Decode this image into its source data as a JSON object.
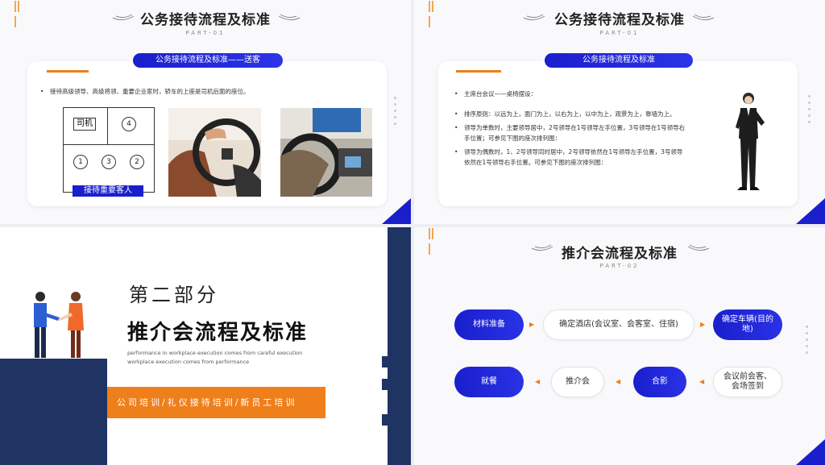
{
  "slide1": {
    "title": "公务接待流程及标准",
    "part": "PART-01",
    "card_title": "公务接待流程及标准——送客",
    "bullet": "接待高级领导、高级将领、重要企业家时，轿车的上座是司机后面的座位。",
    "seat_diagram": {
      "driver": "司机",
      "seats": [
        "4",
        "1",
        "3",
        "2"
      ],
      "label": "接待重要客人"
    }
  },
  "slide2": {
    "title": "公务接待流程及标准",
    "part": "PART-01",
    "card_title": "公务接待流程及标准",
    "bullets": [
      "主席台会议——桌椅摆设：",
      "排序原则：以远为上，面门为上，以右为上，以中为上，观景为上，靠墙为上。",
      "领导为单数时，主要领导居中，2号领导在1号领导左手位置，3号领导在1号领导右手位置；可参见下图的座次排列图：",
      "领导为偶数时，1、2号领导同时居中，2号领导依然在1号领导左手位置，3号领导依然在1号领导右手位置。可参见下图的座次排列图："
    ]
  },
  "slide3": {
    "subtitle": "第二部分",
    "title": "推介会流程及标准",
    "en_line1": "performance in workplace execution comes from careful execution",
    "en_line2": "workplace execution comes from performance",
    "banner": "公司培训/礼仪接待培训/新员工培训"
  },
  "slide4": {
    "title": "推介会流程及标准",
    "part": "PART-02",
    "flow_row1": [
      "材料准备",
      "确定酒店(会议室、会客室、住宿)",
      "确定车辆(目的地)"
    ],
    "flow_row2": [
      "就餐",
      "推介会",
      "合影",
      "会议前会客、会场签到"
    ]
  },
  "colors": {
    "accent": "#1a1fcc",
    "orange": "#ef7f1a",
    "navy": "#1f3463"
  }
}
